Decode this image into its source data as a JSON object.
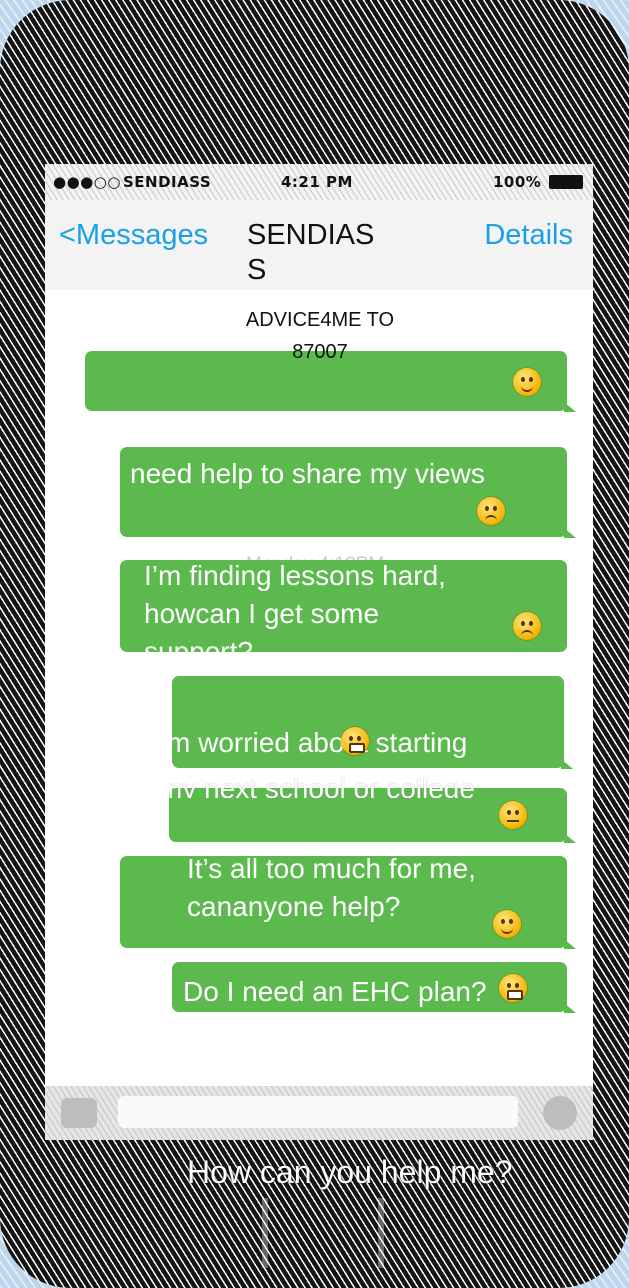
{
  "status_bar": {
    "carrier": "SENDIASS",
    "time": "4:21 PM",
    "battery": "100%"
  },
  "nav": {
    "back_label": "<Messages",
    "title": "SENDIASS",
    "details_label": "Details"
  },
  "thread": {
    "contact_line": "ADVICE4ME TO 87007",
    "timestamp": "Monday 4:18PM",
    "messages": [
      {
        "text": "",
        "emoji": "smiling-face"
      },
      {
        "text": "need help to share my views",
        "emoji": "worried-face"
      },
      {
        "line1": "I’m finding lessons hard,",
        "line2": "howcan I get some",
        "line3": "support?",
        "emoji": "sad-face"
      },
      {
        "line1": "I’m worried about starting",
        "line2": "my next school or college",
        "emoji_top": "grimacing-face",
        "emoji_bottom": "neutral-face"
      },
      {
        "line1": "It’s all too much for me,",
        "line2": "cananyone help?",
        "emoji": "flushed-face"
      },
      {
        "text": "Do I need an EHC plan?",
        "emoji": "grimacing-face"
      }
    ]
  },
  "caption": "How can you help me?",
  "colors": {
    "bubble": "#5bb94e",
    "link": "#1aa0e6"
  }
}
